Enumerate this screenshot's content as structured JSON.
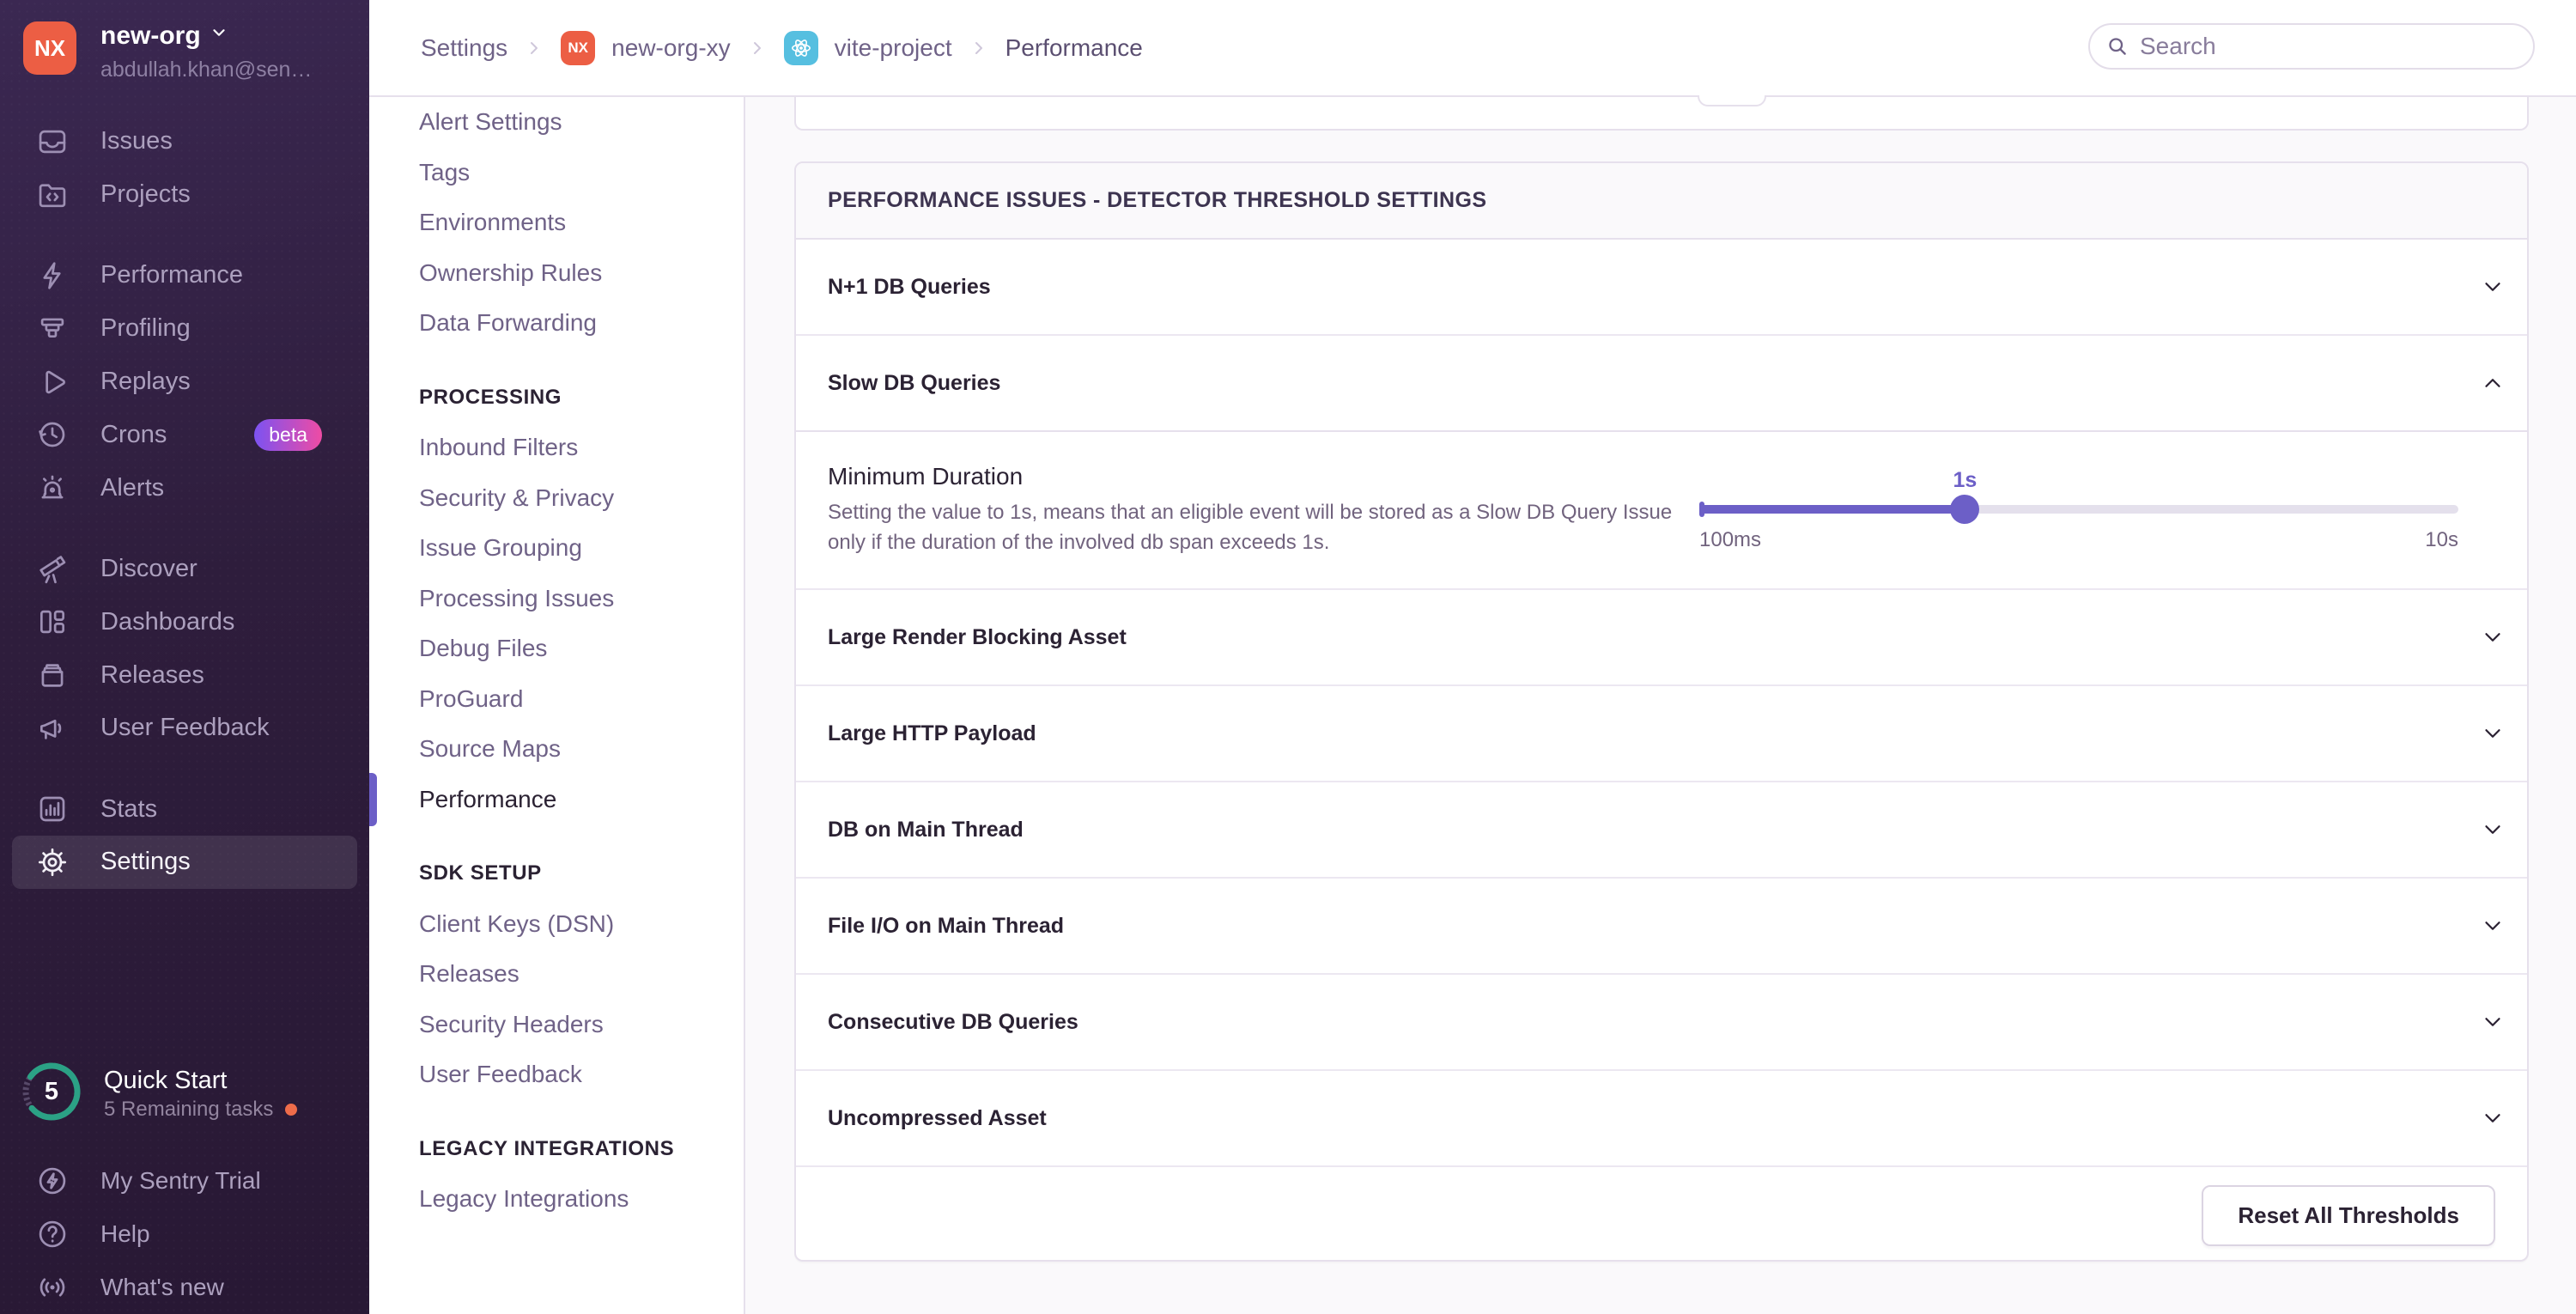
{
  "sidebar": {
    "org": {
      "initials": "NX",
      "name": "new-org",
      "email": "abdullah.khan@sen…"
    },
    "nav": [
      {
        "icon": "issues-icon",
        "label": "Issues"
      },
      {
        "icon": "projects-icon",
        "label": "Projects"
      },
      {
        "icon": "lightning-icon",
        "label": "Performance"
      },
      {
        "icon": "profiling-icon",
        "label": "Profiling"
      },
      {
        "icon": "play-icon",
        "label": "Replays"
      },
      {
        "icon": "clock-icon",
        "label": "Crons",
        "badge": "beta"
      },
      {
        "icon": "siren-icon",
        "label": "Alerts"
      },
      {
        "icon": "telescope-icon",
        "label": "Discover"
      },
      {
        "icon": "dashboards-icon",
        "label": "Dashboards"
      },
      {
        "icon": "archive-icon",
        "label": "Releases"
      },
      {
        "icon": "megaphone-icon",
        "label": "User Feedback"
      },
      {
        "icon": "bar-chart-icon",
        "label": "Stats"
      },
      {
        "icon": "gear-icon",
        "label": "Settings"
      }
    ],
    "active_item": "Settings",
    "quick_start": {
      "count": "5",
      "title": "Quick Start",
      "subtitle": "5 Remaining tasks"
    },
    "footer_nav": [
      {
        "icon": "trial-lightning-icon",
        "label": "My Sentry Trial"
      },
      {
        "icon": "help-icon",
        "label": "Help"
      },
      {
        "icon": "broadcast-icon",
        "label": "What's new"
      }
    ]
  },
  "header": {
    "breadcrumbs": {
      "settings": "Settings",
      "org_badge": "NX",
      "org": "new-org-xy",
      "project": "vite-project",
      "page": "Performance"
    },
    "search_placeholder": "Search"
  },
  "subnav": {
    "items_top": [
      "Alert Settings",
      "Tags",
      "Environments",
      "Ownership Rules",
      "Data Forwarding"
    ],
    "heading_processing": "PROCESSING",
    "items_processing": [
      "Inbound Filters",
      "Security & Privacy",
      "Issue Grouping",
      "Processing Issues",
      "Debug Files",
      "ProGuard",
      "Source Maps",
      "Performance"
    ],
    "heading_sdk": "SDK SETUP",
    "items_sdk": [
      "Client Keys (DSN)",
      "Releases",
      "Security Headers",
      "User Feedback"
    ],
    "heading_legacy": "LEGACY INTEGRATIONS",
    "items_legacy": [
      "Legacy Integrations"
    ],
    "active_item": "Performance"
  },
  "panel": {
    "title": "PERFORMANCE ISSUES - DETECTOR THRESHOLD SETTINGS",
    "rows": [
      {
        "label": "N+1 DB Queries",
        "state": "collapsed"
      },
      {
        "label": "Slow DB Queries",
        "state": "expanded"
      },
      {
        "label": "Large Render Blocking Asset",
        "state": "collapsed"
      },
      {
        "label": "Large HTTP Payload",
        "state": "collapsed"
      },
      {
        "label": "DB on Main Thread",
        "state": "collapsed"
      },
      {
        "label": "File I/O on Main Thread",
        "state": "collapsed"
      },
      {
        "label": "Consecutive DB Queries",
        "state": "collapsed"
      },
      {
        "label": "Uncompressed Asset",
        "state": "collapsed"
      }
    ],
    "detail": {
      "title": "Minimum Duration",
      "description": "Setting the value to 1s, means that an eligible event will be stored as a Slow DB Query Issue only if the duration of the involved db span exceeds 1s.",
      "slider": {
        "value_label": "1s",
        "min_label": "100ms",
        "max_label": "10s",
        "percent": 35
      }
    },
    "reset_button": "Reset All Thresholds"
  },
  "colors": {
    "accent_purple": "#6C5FC7",
    "sidebar_bg": "#2E1D3C",
    "org_avatar_orange": "#EC5E44",
    "react_badge_cyan": "#56BFE0",
    "beta_gradient_start": "#7C52F1",
    "beta_gradient_end": "#EE4CA4",
    "quickstart_teal": "#2BA185",
    "notification_dot_orange": "#EE6C4A",
    "border": "#E6E0EC",
    "heading_text": "#2B2233",
    "muted_text": "#71637E"
  }
}
